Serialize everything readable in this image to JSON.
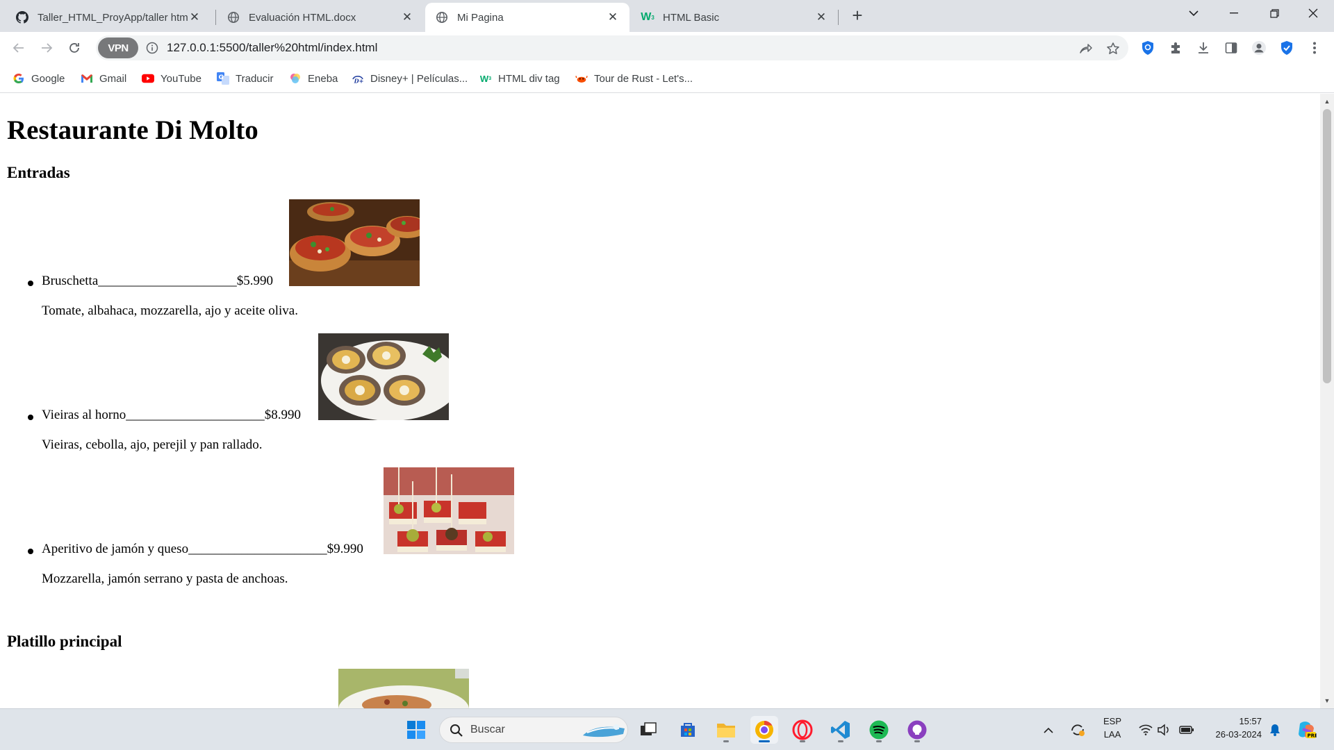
{
  "browser": {
    "tabs": [
      {
        "title": "Taller_HTML_ProyApp/taller html",
        "icon": "github-icon",
        "active": false
      },
      {
        "title": "Evaluación HTML.docx",
        "icon": "globe-icon",
        "active": false
      },
      {
        "title": "Mi Pagina",
        "icon": "globe-icon",
        "active": true
      },
      {
        "title": "HTML Basic",
        "icon": "w3schools-icon",
        "active": false
      }
    ],
    "url": "127.0.0.1:5500/taller%20html/index.html",
    "vpn_label": "VPN",
    "bookmarks": [
      {
        "label": "Google",
        "icon": "google-icon"
      },
      {
        "label": "Gmail",
        "icon": "gmail-icon"
      },
      {
        "label": "YouTube",
        "icon": "youtube-icon"
      },
      {
        "label": "Traducir",
        "icon": "translate-icon"
      },
      {
        "label": "Eneba",
        "icon": "eneba-icon"
      },
      {
        "label": "Disney+ | Películas...",
        "icon": "disney-icon"
      },
      {
        "label": "HTML div tag",
        "icon": "w3schools-icon"
      },
      {
        "label": "Tour de Rust - Let's...",
        "icon": "rust-crab-icon"
      }
    ]
  },
  "page": {
    "title": "Restaurante Di Molto",
    "sections": [
      {
        "heading": "Entradas",
        "items": [
          {
            "line": "Bruschetta_____________________$5.990",
            "description": "Tomate, albahaca, mozzarella, ajo y aceite oliva.",
            "image": "bruschetta-photo"
          },
          {
            "line": "Vieiras al horno_____________________$8.990",
            "description": "Vieiras, cebolla, ajo, perejil y pan rallado.",
            "image": "scallops-photo"
          },
          {
            "line": "Aperitivo de jamón y queso_____________________$9.990",
            "description": "Mozzarella, jamón serrano y pasta de anchoas.",
            "image": "ham-cheese-skewers-photo"
          }
        ]
      },
      {
        "heading": "Platillo principal",
        "items": []
      }
    ]
  },
  "taskbar": {
    "search_label": "Buscar",
    "language_top": "ESP",
    "language_bottom": "LAA",
    "time": "15:57",
    "date": "26-03-2024"
  },
  "colors": {
    "tabstrip_bg": "#dee1e6",
    "taskbar_bg": "#dfe4ea",
    "accent_blue": "#0067c0"
  }
}
